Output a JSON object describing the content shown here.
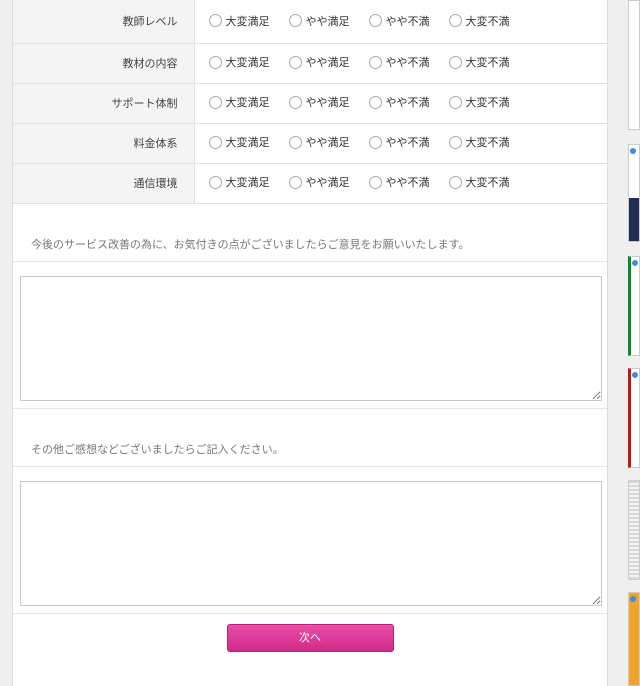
{
  "rating_rows": [
    {
      "label": "教師レベル"
    },
    {
      "label": "教材の内容"
    },
    {
      "label": "サポート体制"
    },
    {
      "label": "料金体系"
    },
    {
      "label": "通信環境"
    }
  ],
  "rating_options": [
    "大変満足",
    "やや満足",
    "やや不満",
    "大変不満"
  ],
  "improvement": {
    "prompt": "今後のサービス改善の為に、お気付きの点がございましたらご意見をお願いいたします。",
    "value": ""
  },
  "other": {
    "prompt": "その他ご感想などございましたらご記入ください。",
    "value": ""
  },
  "next_button": {
    "label": "次へ",
    "color": "#d9338f"
  }
}
